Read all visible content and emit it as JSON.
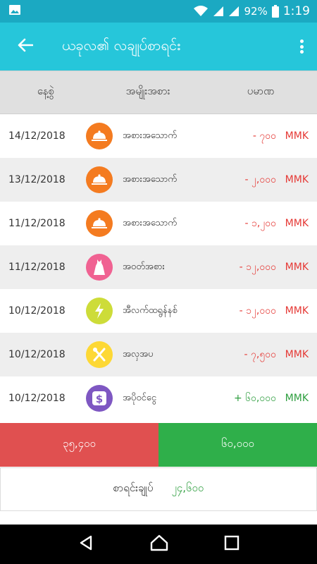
{
  "status": {
    "battery": "92%",
    "time": "1:19",
    "left_icon": "image-icon"
  },
  "app_bar": {
    "title": "ယခုလ၏ လချုပ်စာရင်း",
    "back_icon": "arrow-back-icon",
    "menu_icon": "more-vert-icon"
  },
  "header": {
    "date": "နေ့စွဲ",
    "category": "အမျိုးအစား",
    "amount": "ပမာဏ"
  },
  "transactions": [
    {
      "date": "14/12/2018",
      "category": "အစားအသောက်",
      "amount": "- ၇၀၀",
      "currency": "MMK",
      "type": "expense",
      "icon": "food-cloche-icon",
      "icon_color": "#f47b20"
    },
    {
      "date": "13/12/2018",
      "category": "အစားအသောက်",
      "amount": "- ၂,၀၀၀",
      "currency": "MMK",
      "type": "expense",
      "icon": "food-cloche-icon",
      "icon_color": "#f47b20"
    },
    {
      "date": "11/12/2018",
      "category": "အစားအသောက်",
      "amount": "- ၁,၂၀၀",
      "currency": "MMK",
      "type": "expense",
      "icon": "food-cloche-icon",
      "icon_color": "#f47b20"
    },
    {
      "date": "11/12/2018",
      "category": "အဝတ်အစား",
      "amount": "- ၁၂,၀၀၀",
      "currency": "MMK",
      "type": "expense",
      "icon": "dress-icon",
      "icon_color": "#f06292"
    },
    {
      "date": "10/12/2018",
      "category": "အီလက်ထရွန်နစ်",
      "amount": "- ၁၂,၀၀၀",
      "currency": "MMK",
      "type": "expense",
      "icon": "lightning-icon",
      "icon_color": "#cddc39"
    },
    {
      "date": "10/12/2018",
      "category": "အလှအပ",
      "amount": "- ၇,၅၀၀",
      "currency": "MMK",
      "type": "expense",
      "icon": "beauty-tools-icon",
      "icon_color": "#fdd835"
    },
    {
      "date": "10/12/2018",
      "category": "အပိုဝင်ငွေ",
      "amount": "+ ၆၀,၀၀၀",
      "currency": "MMK",
      "type": "income",
      "icon": "dollar-icon",
      "icon_color": "#7e57c2"
    }
  ],
  "totals": {
    "expense": "၃၅,၄၀၀",
    "income": "၆၀,၀၀၀",
    "expense_color": "#e05050",
    "income_color": "#2faf4a"
  },
  "balance": {
    "label": "စာရင်းချုပ်",
    "value": "၂၄,၆၀၀"
  },
  "nav": {
    "back_icon": "nav-back-icon",
    "home_icon": "nav-home-icon",
    "recents_icon": "nav-recents-icon"
  }
}
